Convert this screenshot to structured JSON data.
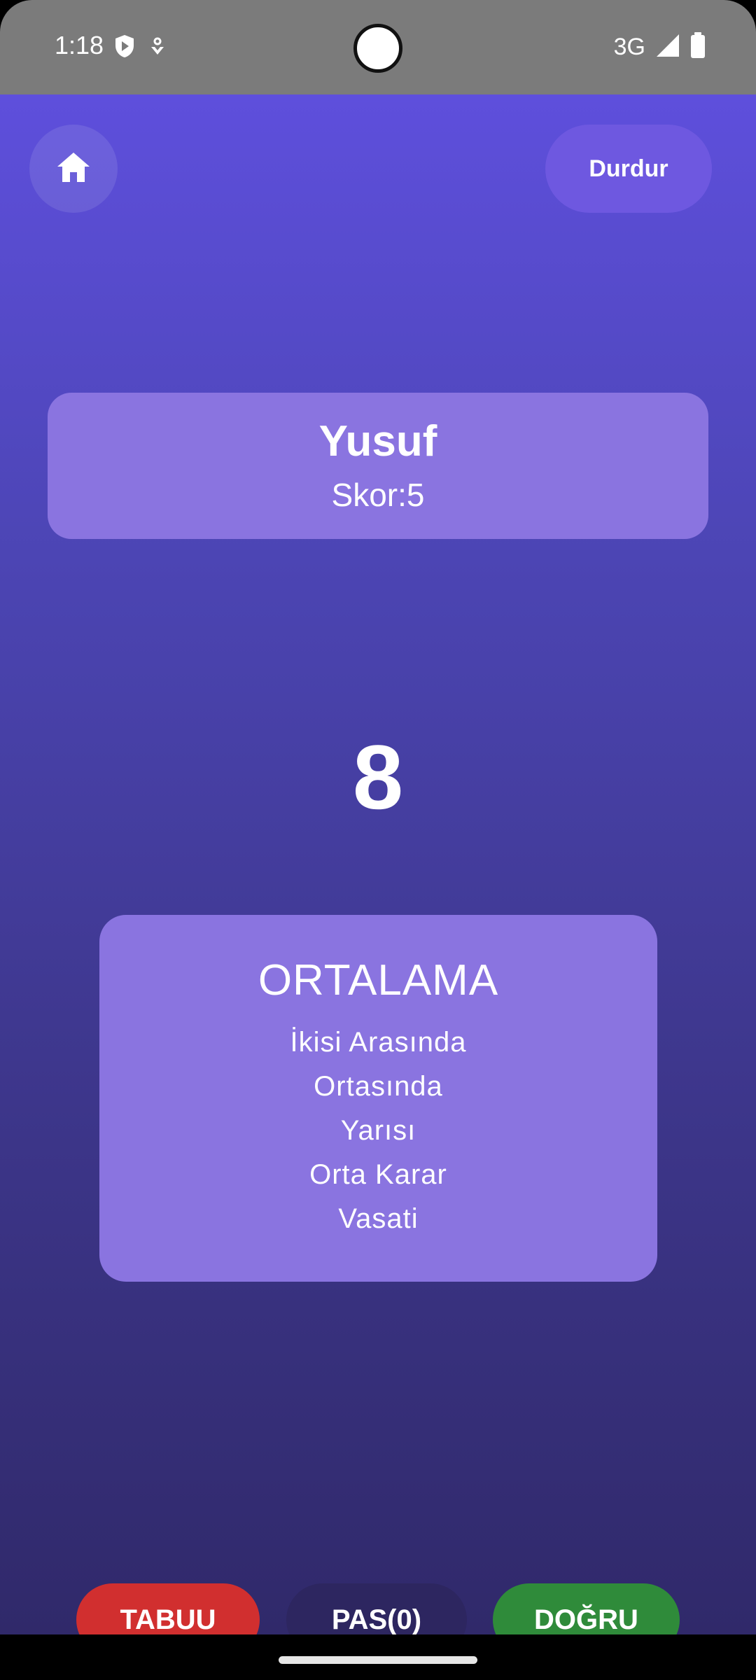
{
  "status_bar": {
    "time": "1:18",
    "network": "3G",
    "icons": [
      "shield-icon",
      "assistant-icon",
      "signal-icon",
      "battery-icon"
    ]
  },
  "header": {
    "home_icon": "home-icon",
    "pause_label": "Durdur"
  },
  "player": {
    "name": "Yusuf",
    "score_text": "Skor:5"
  },
  "timer": {
    "value": "8"
  },
  "card": {
    "word": "ORTALAMA",
    "taboo_words": [
      "İkisi Arasında",
      "Ortasında",
      "Yarısı",
      "Orta Karar",
      "Vasati"
    ]
  },
  "actions": {
    "taboo_label": "TABUU",
    "pass_label": "PAS(0)",
    "correct_label": "DOĞRU"
  },
  "colors": {
    "gradient_top": "#5e4fdc",
    "gradient_bottom": "#30296a",
    "card": "#8a74e0",
    "taboo": "#d12f2f",
    "pass": "#2d2660",
    "correct": "#2f8b3a"
  }
}
